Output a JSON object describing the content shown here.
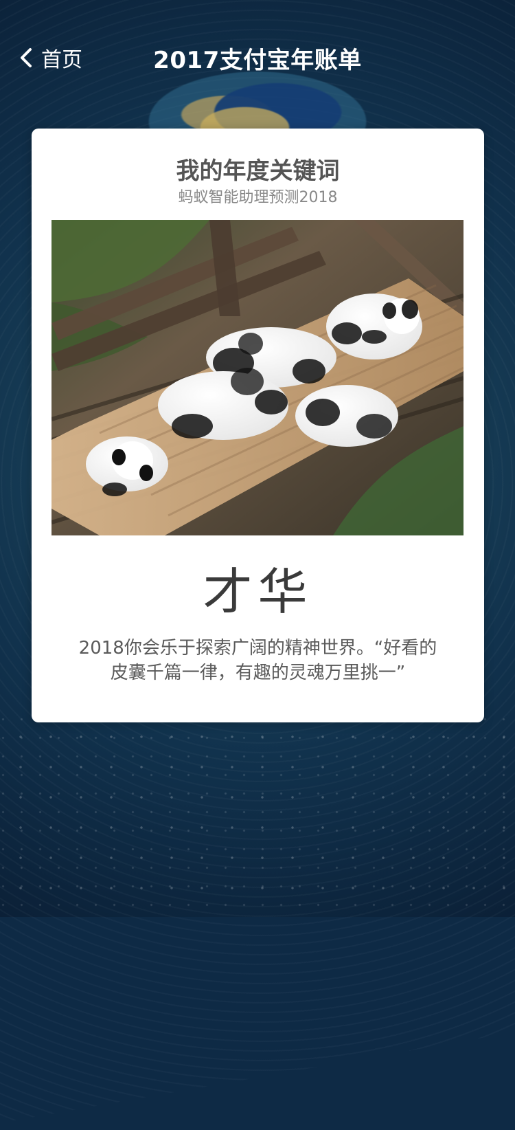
{
  "header": {
    "back_label": "首页",
    "title": "2017支付宝年账单"
  },
  "card": {
    "title": "我的年度关键词",
    "subtitle": "蚂蚁智能助理预测2018",
    "photo": {
      "subject": "pandas-on-wooden-boards"
    },
    "keyword": "才华",
    "description": "2018你会乐于探索广阔的精神世界。“好看的皮囊千篇一律，有趣的灵魂万里挑一”"
  },
  "icons": {
    "back": "chevron-left-icon"
  },
  "colors": {
    "card_bg": "#ffffff",
    "header_text": "#ffffff",
    "title_text": "#555555",
    "subtitle_text": "#888888",
    "keyword_text": "#3a3a3a",
    "desc_text": "#5a5a5a"
  }
}
